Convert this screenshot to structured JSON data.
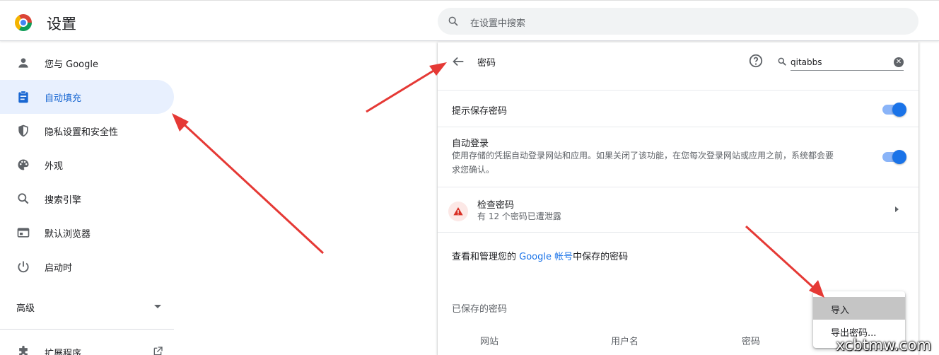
{
  "header": {
    "title": "设置",
    "search_placeholder": "在设置中搜索"
  },
  "sidebar": {
    "items": [
      {
        "label": "您与 Google",
        "icon": "person-icon"
      },
      {
        "label": "自动填充",
        "icon": "clipboard-icon",
        "active": true
      },
      {
        "label": "隐私设置和安全性",
        "icon": "shield-icon"
      },
      {
        "label": "外观",
        "icon": "palette-icon"
      },
      {
        "label": "搜索引擎",
        "icon": "search-icon"
      },
      {
        "label": "默认浏览器",
        "icon": "browser-icon"
      },
      {
        "label": "启动时",
        "icon": "power-icon"
      }
    ],
    "advanced_label": "高级",
    "extensions_label": "扩展程序"
  },
  "passwords": {
    "title": "密码",
    "search_value": "qitabbs",
    "offer_to_save": {
      "label": "提示保存密码",
      "enabled": true
    },
    "auto_signin": {
      "label": "自动登录",
      "description_line1": "使用存储的凭据自动登录网站和应用。如果关闭了该功能，在您每次登录网站或应用之前，系统都会要",
      "description_line2": "求您确认。",
      "enabled": true
    },
    "check": {
      "label": "检查密码",
      "sub": "有 12 个密码已遭泄露"
    },
    "manage_prefix": "查看和管理您的 ",
    "manage_link": "Google 帐号",
    "manage_suffix": "中保存的密码",
    "saved_title": "已保存的密码",
    "columns": [
      "网站",
      "用户名",
      "密码"
    ]
  },
  "menu": {
    "items": [
      "导入",
      "导出密码..."
    ]
  },
  "colors": {
    "accent": "#1a73e8",
    "active_bg": "#e8f0fe",
    "arrow": "#e53935",
    "warning": "#d93025"
  },
  "watermark": "xcbtmw.com"
}
